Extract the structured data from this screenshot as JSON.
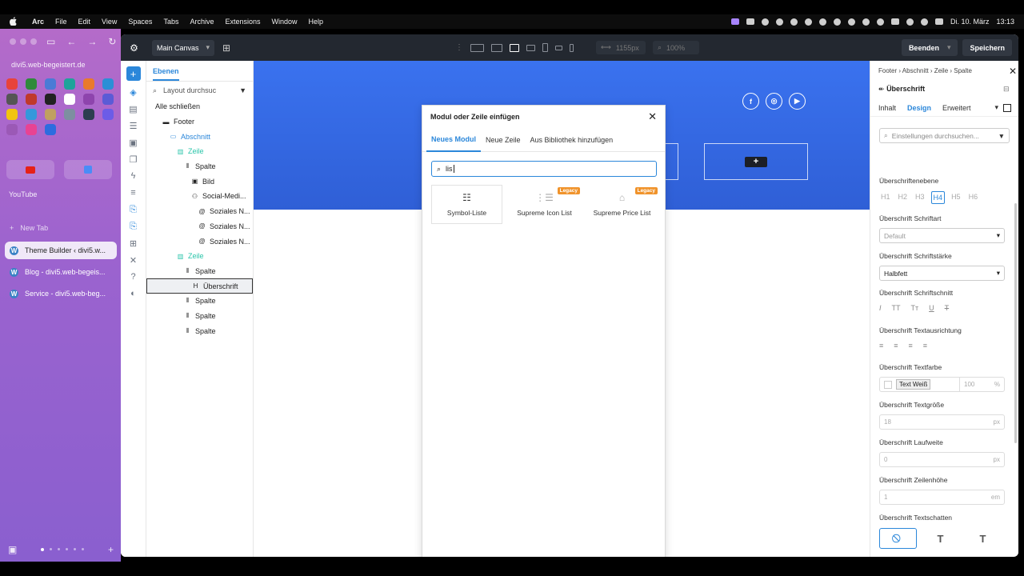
{
  "menubar": {
    "apple": "",
    "items": [
      "Arc",
      "File",
      "Edit",
      "View",
      "Spaces",
      "Tabs",
      "Archive",
      "Extensions",
      "Window",
      "Help"
    ],
    "date": "Di. 10. März",
    "time": "13:13"
  },
  "arc": {
    "url": "divi5.web-begeistert.de",
    "space_label": "YouTube",
    "new_tab_label": "New Tab",
    "tabs": [
      {
        "label": "Theme Builder ‹ divi5.w...",
        "active": true
      },
      {
        "label": "Blog - divi5.web-begeis...",
        "active": false
      },
      {
        "label": "Service - divi5.web-beg...",
        "active": false
      }
    ],
    "favicon_colors": [
      "#e8433b",
      "#2f8a3a",
      "#4a7bd6",
      "#1fa39a",
      "#e97a2b",
      "#2b8fd6",
      "#555555",
      "#c0392b",
      "#222222",
      "#ffffff",
      "#8e44ad",
      "#5b5bd6",
      "#f1c40f",
      "#3498db",
      "#c0a060",
      "#7d8fa0",
      "#2c3e50",
      "#6c5ce7",
      "#9b59b6",
      "#e84393",
      "#2d6cdf"
    ]
  },
  "toolbar": {
    "canvas_select": "Main Canvas",
    "width_field": "1155px",
    "zoom_field": "100%",
    "exit_button": "Beenden",
    "save_button": "Speichern"
  },
  "layers": {
    "tab": "Ebenen",
    "search_placeholder": "Layout durchsuc",
    "collapse_all": "Alle schließen",
    "rows": [
      {
        "label": "Footer",
        "indent": 0,
        "kind": "default",
        "icon": "footer-icon"
      },
      {
        "label": "Abschnitt",
        "indent": 1,
        "kind": "blue",
        "icon": "section-icon"
      },
      {
        "label": "Zeile",
        "indent": 2,
        "kind": "green",
        "icon": "row-icon"
      },
      {
        "label": "Spalte",
        "indent": 3,
        "kind": "default",
        "icon": "column-icon"
      },
      {
        "label": "Bild",
        "indent": 4,
        "kind": "default",
        "icon": "image-icon"
      },
      {
        "label": "Social-Medi...",
        "indent": 4,
        "kind": "default",
        "icon": "social-icon"
      },
      {
        "label": "Soziales N...",
        "indent": 5,
        "kind": "default",
        "icon": "at-icon"
      },
      {
        "label": "Soziales N...",
        "indent": 5,
        "kind": "default",
        "icon": "at-icon"
      },
      {
        "label": "Soziales N...",
        "indent": 5,
        "kind": "default",
        "icon": "at-icon"
      },
      {
        "label": "Zeile",
        "indent": 2,
        "kind": "green",
        "icon": "row-icon"
      },
      {
        "label": "Spalte",
        "indent": 3,
        "kind": "default",
        "icon": "column-icon"
      },
      {
        "label": "Überschrift",
        "indent": 4,
        "kind": "selected",
        "icon": "heading-icon"
      },
      {
        "label": "Spalte",
        "indent": 3,
        "kind": "default",
        "icon": "column-icon"
      },
      {
        "label": "Spalte",
        "indent": 3,
        "kind": "default",
        "icon": "column-icon"
      },
      {
        "label": "Spalte",
        "indent": 3,
        "kind": "default",
        "icon": "column-icon"
      }
    ]
  },
  "modal": {
    "title": "Modul oder Zeile einfügen",
    "tabs": [
      "Neues Modul",
      "Neue Zeile",
      "Aus Bibliothek hinzufügen"
    ],
    "search_value": "lis",
    "legacy_badge": "Legacy",
    "modules": [
      {
        "label": "Symbol-Liste",
        "icon": "list-icon",
        "legacy": false
      },
      {
        "label": "Supreme Icon List",
        "icon": "icon-list-icon",
        "legacy": true
      },
      {
        "label": "Supreme Price List",
        "icon": "price-list-icon",
        "legacy": true
      }
    ]
  },
  "canvas": {
    "social": [
      "f",
      "◎",
      "▶"
    ],
    "add_symbol": "+"
  },
  "settings": {
    "breadcrumb": "Footer › Abschnitt › Zeile › Spalte",
    "title": "Überschrift",
    "tabs": [
      "Inhalt",
      "Design",
      "Erweitert"
    ],
    "search_placeholder": "Einstellungen durchsuchen...",
    "heading_level_label": "Überschriftenebene",
    "heading_levels": [
      "H1",
      "H2",
      "H3",
      "H4",
      "H5",
      "H6"
    ],
    "font_label": "Überschrift Schriftart",
    "font_value": "Default",
    "weight_label": "Überschrift Schriftstärke",
    "weight_value": "Halbfett",
    "style_label": "Überschrift Schriftschnitt",
    "align_label": "Überschrift Textausrichtung",
    "color_label": "Überschrift Textfarbe",
    "color_chip": "Text Weiß",
    "color_opacity": "100",
    "color_opacity_unit": "%",
    "size_label": "Überschrift Textgröße",
    "size_value": "18",
    "size_unit": "px",
    "spacing_label": "Überschrift Laufweite",
    "spacing_value": "0",
    "spacing_unit": "px",
    "lineheight_label": "Überschrift Zeilenhöhe",
    "lineheight_value": "1",
    "lineheight_unit": "em",
    "shadow_label": "Überschrift Textschatten"
  }
}
